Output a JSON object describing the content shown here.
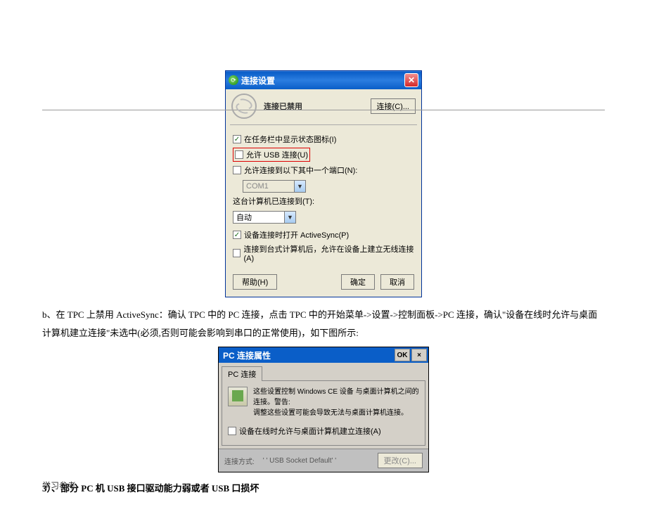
{
  "dialog1": {
    "title": "连接设置",
    "status": "连接已禁用",
    "connect_btn": "连接(C)...",
    "opt_taskbar": "在任务栏中显示状态图标(I)",
    "opt_usb": "允许 USB 连接(U)",
    "opt_port": "允许连接到以下其中一个端口(N):",
    "port_value": "COM1",
    "label_connected": "这台计算机已连接到(T):",
    "connected_value": "自动",
    "opt_activesync": "设备连接时打开 ActiveSync(P)",
    "opt_wireless": "连接到台式计算机后，允许在设备上建立无线连接(A)",
    "btn_help": "帮助(H)",
    "btn_ok": "确定",
    "btn_cancel": "取消"
  },
  "doc": {
    "text_b": "b、在 TPC 上禁用 ActiveSync：确认 TPC 中的 PC 连接，点击 TPC 中的开始菜单->设置->控制面板->PC 连接，确认\"设备在线时允许与桌面计算机建立连接\"未选中(必须,否则可能会影响到串口的正常使用)，如下图所示:",
    "section3": "3）、部分 PC 机 USB 接口驱动能力弱或者 USB 口损坏",
    "footer": "学习参考"
  },
  "dialog2": {
    "title": "PC 连接属性",
    "ok": "OK",
    "close": "×",
    "tab": "PC 连接",
    "info_line1": "这些设置控制 Windows CE 设备 与桌面计算机之间的连接。警告:",
    "info_line2": "调整这些设置可能会导致无法与桌面计算机连接。",
    "checkbox": "设备在线时允许与桌面计算机建立连接(A)",
    "method_label": "连接方式:",
    "method_value": "' ' USB Socket Default' '",
    "change_btn": "更改(C)..."
  }
}
